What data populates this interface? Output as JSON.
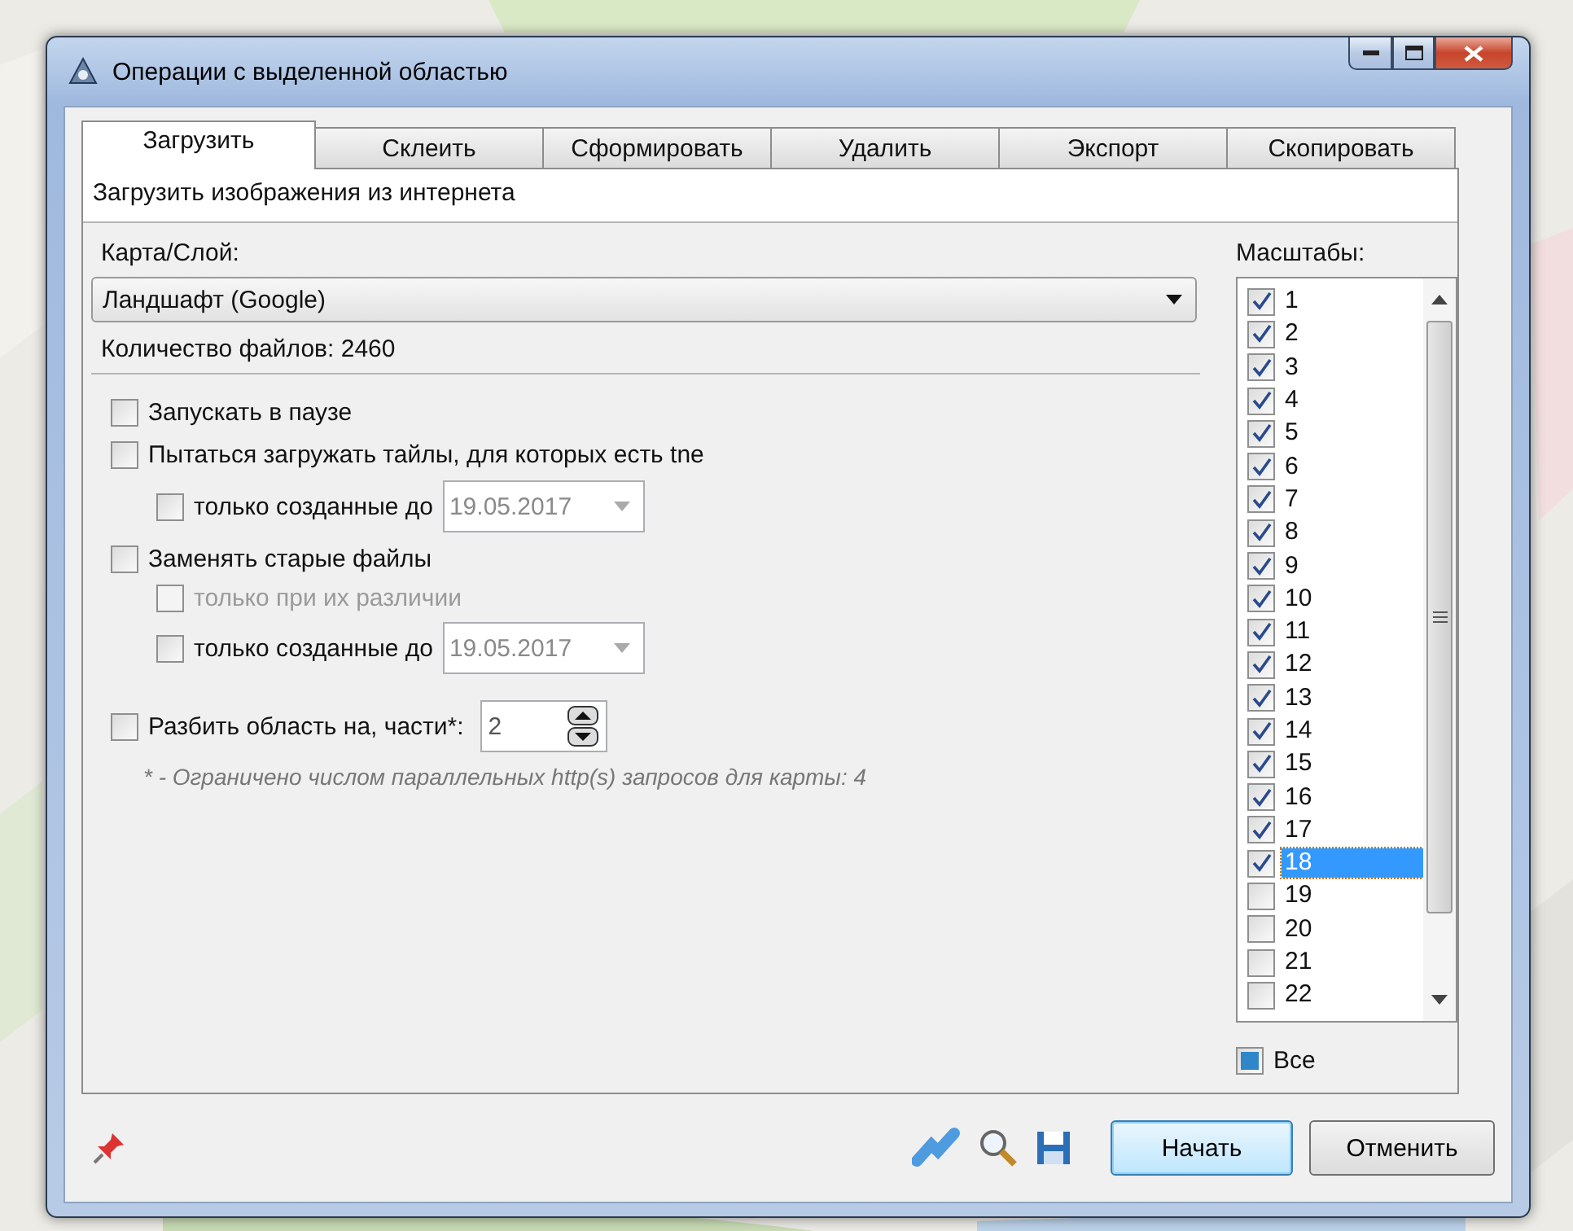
{
  "window": {
    "title": "Операции с выделенной областью"
  },
  "tabs": [
    {
      "label": "Загрузить",
      "selected": true
    },
    {
      "label": "Склеить",
      "selected": false
    },
    {
      "label": "Сформировать",
      "selected": false
    },
    {
      "label": "Удалить",
      "selected": false
    },
    {
      "label": "Экспорт",
      "selected": false
    },
    {
      "label": "Скопировать",
      "selected": false
    }
  ],
  "heading": "Загрузить изображения из интернета",
  "map_layer": {
    "label": "Карта/Слой:",
    "value": "Ландшафт (Google)"
  },
  "file_count": "Количество файлов: 2460",
  "options": [
    {
      "kind": "checkbox",
      "label": "Запускать в паузе",
      "checked": false,
      "disabled": false
    },
    {
      "kind": "checkbox",
      "label": "Пытаться загружать тайлы, для которых есть tne",
      "checked": false,
      "disabled": false,
      "children": [
        {
          "kind": "date",
          "label": "только созданные до",
          "checked": false,
          "disabled": false,
          "date": "19.05.2017",
          "date_disabled": true
        }
      ]
    },
    {
      "kind": "checkbox",
      "label": "Заменять старые файлы",
      "checked": false,
      "disabled": false,
      "children": [
        {
          "kind": "checkbox",
          "label": "только при их различии",
          "checked": false,
          "disabled": true
        },
        {
          "kind": "date",
          "label": "только созданные до",
          "checked": false,
          "disabled": false,
          "date": "19.05.2017",
          "date_disabled": true
        }
      ]
    },
    {
      "kind": "spin",
      "label": "Разбить область на, части*:",
      "checked": false,
      "disabled": false,
      "value": "2"
    }
  ],
  "footnote": "* - Ограничено числом параллельных http(s) запросов для карты: 4",
  "scales": {
    "label": "Масштабы:",
    "items": [
      {
        "label": "1",
        "checked": true,
        "selected": false
      },
      {
        "label": "2",
        "checked": true,
        "selected": false
      },
      {
        "label": "3",
        "checked": true,
        "selected": false
      },
      {
        "label": "4",
        "checked": true,
        "selected": false
      },
      {
        "label": "5",
        "checked": true,
        "selected": false
      },
      {
        "label": "6",
        "checked": true,
        "selected": false
      },
      {
        "label": "7",
        "checked": true,
        "selected": false
      },
      {
        "label": "8",
        "checked": true,
        "selected": false
      },
      {
        "label": "9",
        "checked": true,
        "selected": false
      },
      {
        "label": "10",
        "checked": true,
        "selected": false
      },
      {
        "label": "11",
        "checked": true,
        "selected": false
      },
      {
        "label": "12",
        "checked": true,
        "selected": false
      },
      {
        "label": "13",
        "checked": true,
        "selected": false
      },
      {
        "label": "14",
        "checked": true,
        "selected": false
      },
      {
        "label": "15",
        "checked": true,
        "selected": false
      },
      {
        "label": "16",
        "checked": true,
        "selected": false
      },
      {
        "label": "17",
        "checked": true,
        "selected": false
      },
      {
        "label": "18",
        "checked": true,
        "selected": true
      },
      {
        "label": "19",
        "checked": false,
        "selected": false
      },
      {
        "label": "20",
        "checked": false,
        "selected": false
      },
      {
        "label": "21",
        "checked": false,
        "selected": false
      },
      {
        "label": "22",
        "checked": false,
        "selected": false
      }
    ],
    "all": {
      "label": "Все",
      "checked": false,
      "partial": true
    }
  },
  "buttons": [
    {
      "label": "Начать",
      "default": true
    },
    {
      "label": "Отменить",
      "default": false
    }
  ]
}
